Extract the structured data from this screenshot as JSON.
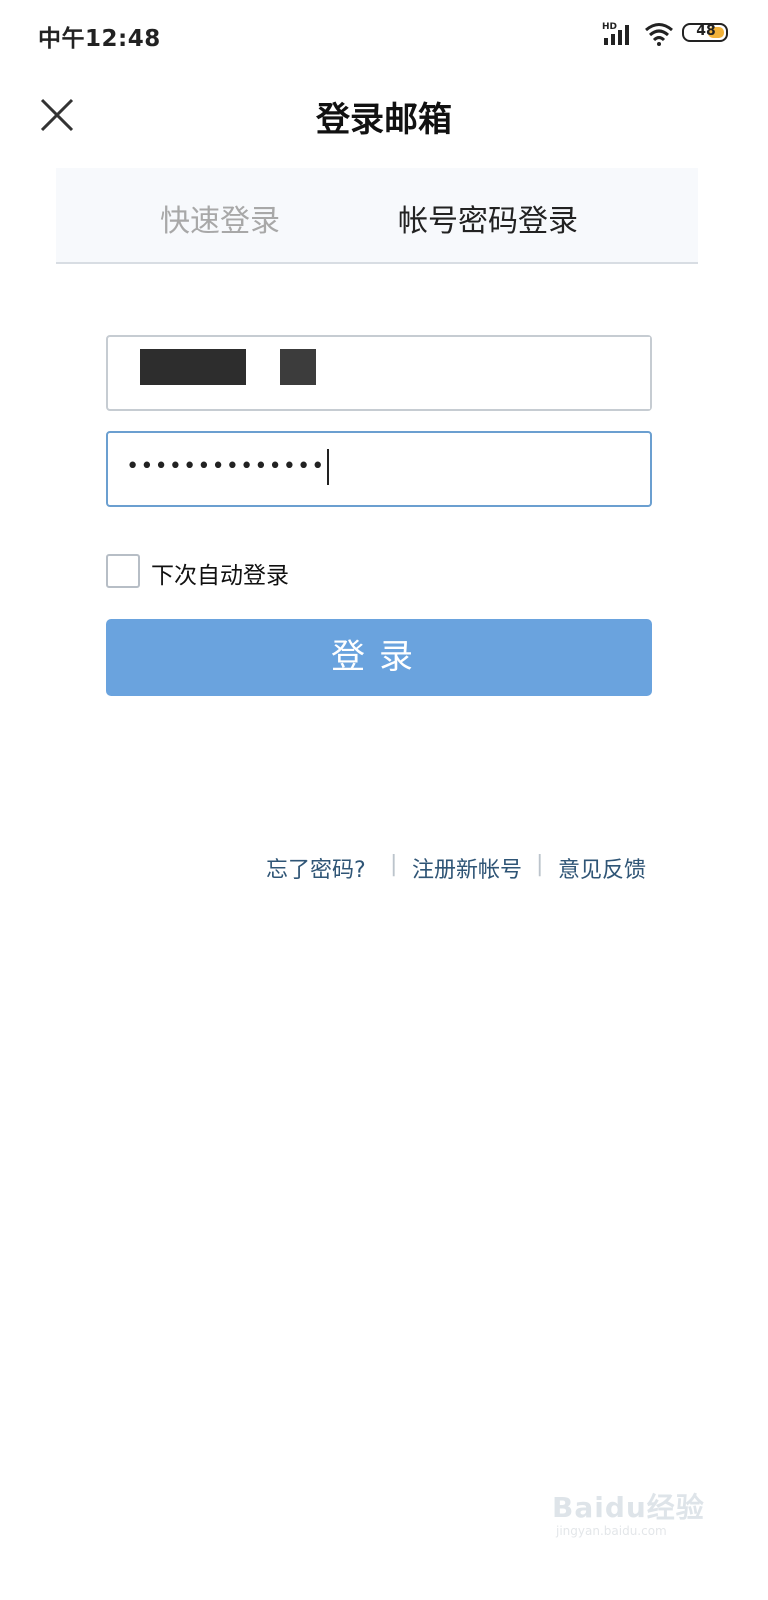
{
  "status_bar": {
    "time": "中午12:48",
    "network": "HD",
    "battery": "48",
    "battery_color": "#f2b23a"
  },
  "header": {
    "title": "登录邮箱",
    "close_icon": "close-icon"
  },
  "tabs": [
    {
      "label": "快速登录",
      "active": false
    },
    {
      "label": "帐号密码登录",
      "active": true
    }
  ],
  "form": {
    "username_value": "",
    "password_value": "••••••••••••••",
    "remember_label": "下次自动登录",
    "remember_checked": false,
    "login_label": "登录",
    "login_color": "#6aa3de"
  },
  "links": {
    "forgot": "忘了密码?",
    "register": "注册新帐号",
    "feedback": "意见反馈",
    "separator": "|"
  },
  "watermark": {
    "brand": "Baidu经验",
    "url": "jingyan.baidu.com"
  }
}
